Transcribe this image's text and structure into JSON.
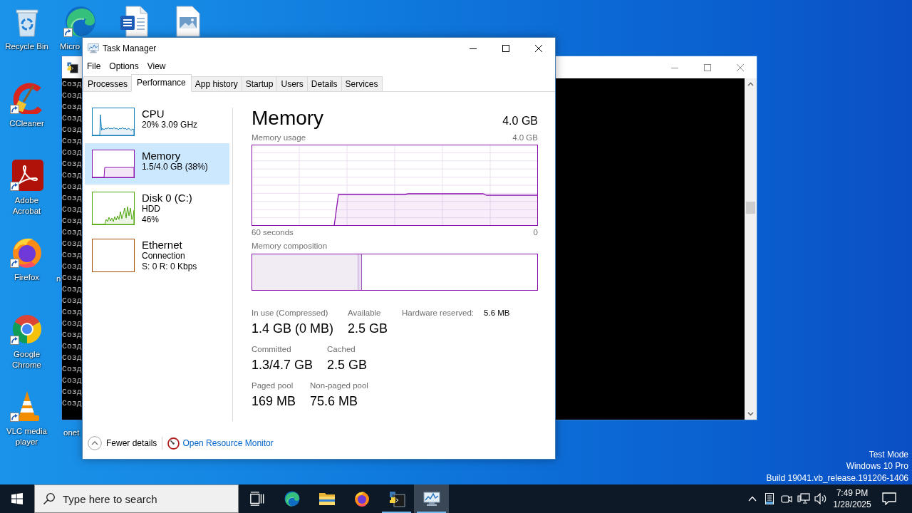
{
  "desktop": {
    "icons": [
      {
        "kind": "recycle-bin",
        "label": "Recycle Bin",
        "shortcut": false
      },
      {
        "kind": "edge",
        "label": "Micro",
        "shortcut": true
      },
      {
        "kind": "word-document",
        "shortcut": false
      },
      {
        "kind": "image-file",
        "shortcut": false
      },
      {
        "kind": "ccleaner",
        "label": "CCleaner",
        "shortcut": true
      },
      {
        "kind": "acrobat",
        "label": "Adobe Acrobat",
        "shortcut": true
      },
      {
        "kind": "firefox",
        "label": "Firefox",
        "shortcut": true
      },
      {
        "kind": "chrome",
        "label": "Google Chrome",
        "shortcut": true
      },
      {
        "kind": "vlc",
        "label": "VLC media player",
        "shortcut": true
      }
    ],
    "label_fragments": [
      "n",
      "onet"
    ],
    "system_info": [
      "Test Mode",
      "Windows 10 Pro",
      "Build 19041.vb_release.191206-1406"
    ]
  },
  "console_window": {
    "lines": [
      "Созд",
      "Созд",
      "Созд",
      "Созд",
      "Созд",
      "Созд",
      "Созд",
      "Созд",
      "Созд",
      "Созд",
      "Созд",
      "Созд",
      "Созд",
      "Созд",
      "Созд",
      "Созд",
      "Созд",
      "Созд",
      "Созд",
      "Созд",
      "Созд",
      "Созд",
      "Созд",
      "Созд",
      "Созд",
      "Созд",
      "Созд",
      "Созд",
      "Созд"
    ]
  },
  "task_manager": {
    "title": "Task Manager",
    "menu": [
      "File",
      "Options",
      "View"
    ],
    "tabs": [
      {
        "label": "Processes",
        "selected": false
      },
      {
        "label": "Performance",
        "selected": true
      },
      {
        "label": "App history",
        "selected": false
      },
      {
        "label": "Startup",
        "selected": false
      },
      {
        "label": "Users",
        "selected": false
      },
      {
        "label": "Details",
        "selected": false
      },
      {
        "label": "Services",
        "selected": false
      }
    ],
    "sidebar": {
      "items": [
        {
          "kind": "cpu",
          "title": "CPU",
          "lines": [
            "20% 3.09 GHz"
          ],
          "color": "#117dbb",
          "selected": false
        },
        {
          "kind": "memory",
          "title": "Memory",
          "lines": [
            "1.5/4.0 GB (38%)"
          ],
          "color": "#8b12ae",
          "selected": true
        },
        {
          "kind": "disk",
          "title": "Disk 0 (C:)",
          "lines": [
            "HDD",
            "46%"
          ],
          "color": "#4da60c",
          "selected": false
        },
        {
          "kind": "network",
          "title": "Ethernet",
          "lines": [
            "Connection",
            "S: 0 R: 0 Kbps"
          ],
          "color": "#a74f01",
          "selected": false
        }
      ]
    },
    "detail": {
      "title": "Memory",
      "total": "4.0 GB",
      "usage_graph": {
        "title": "Memory usage",
        "scale_label": "4.0 GB",
        "axis_labels": [
          "60 seconds",
          "0"
        ]
      },
      "composition": {
        "label": "Memory composition",
        "level": 0.37
      },
      "stats": [
        [
          {
            "kind": "stacked",
            "label": "In use (Compressed)",
            "value": "1.4 GB (0 MB)"
          },
          {
            "kind": "stacked",
            "label": "Available",
            "value": "2.5 GB"
          },
          {
            "kind": "inline",
            "label": "Hardware reserved:",
            "value": "5.6 MB"
          }
        ],
        [
          {
            "kind": "stacked",
            "label": "Committed",
            "value": "1.3/4.7 GB"
          },
          {
            "kind": "stacked",
            "label": "Cached",
            "value": "2.5 GB"
          }
        ],
        [
          {
            "kind": "stacked",
            "label": "Paged pool",
            "value": "169 MB"
          },
          {
            "kind": "stacked",
            "label": "Non-paged pool",
            "value": "75.6 MB"
          }
        ]
      ]
    },
    "footer": {
      "fewer_details": "Fewer details",
      "resource_monitor_link": "Open Resource Monitor"
    }
  },
  "taskbar": {
    "search": {
      "placeholder": "Type here to search"
    },
    "apps": [
      {
        "kind": "task-view",
        "running": false,
        "selected": false
      },
      {
        "kind": "edge",
        "running": false,
        "selected": false
      },
      {
        "kind": "explorer",
        "running": false,
        "selected": false
      },
      {
        "kind": "firefox",
        "running": false,
        "selected": false
      },
      {
        "kind": "python",
        "running": true,
        "selected": false
      },
      {
        "kind": "task-manager",
        "running": true,
        "selected": true
      }
    ],
    "clock": {
      "time": "7:49 PM",
      "date": "1/28/2025"
    }
  }
}
